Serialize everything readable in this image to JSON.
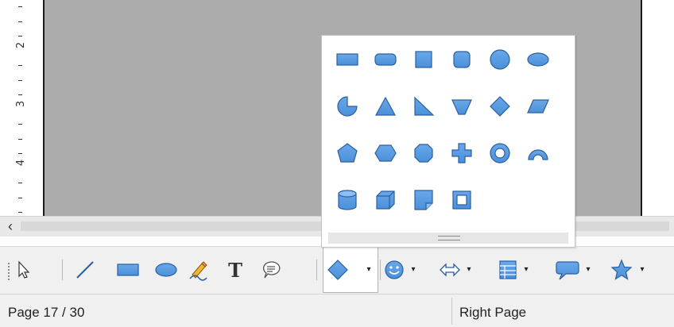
{
  "ruler": {
    "numbers": [
      "2",
      "3",
      "4"
    ]
  },
  "hscroll": {
    "left_arrow": "‹"
  },
  "drawing_toolbar": {
    "tools": [
      {
        "name": "select",
        "icon": "arrow-pointer-icon"
      },
      {
        "name": "line",
        "icon": "line-icon"
      },
      {
        "name": "rectangle",
        "icon": "rectangle-icon"
      },
      {
        "name": "ellipse",
        "icon": "ellipse-icon"
      },
      {
        "name": "freeform-line",
        "icon": "pencil-icon"
      },
      {
        "name": "text",
        "icon": "text-icon",
        "label": "T"
      },
      {
        "name": "callouts",
        "icon": "callout-icon"
      },
      {
        "name": "basic-shapes",
        "icon": "diamond-icon",
        "dropdown": true,
        "active": true
      },
      {
        "name": "symbol-shapes",
        "icon": "smiley-icon",
        "dropdown": true
      },
      {
        "name": "block-arrows",
        "icon": "double-arrow-icon",
        "dropdown": true
      },
      {
        "name": "flowchart",
        "icon": "flowchart-icon",
        "dropdown": true
      },
      {
        "name": "callout-shapes",
        "icon": "speech-bubble-icon",
        "dropdown": true
      },
      {
        "name": "stars",
        "icon": "star-icon",
        "dropdown": true
      }
    ],
    "dropdown_glyph": "▾"
  },
  "shape_popup": {
    "rows": [
      [
        "rectangle",
        "rounded-rectangle",
        "square",
        "rounded-square",
        "circle",
        "ellipse"
      ],
      [
        "circle-pie",
        "isosceles-triangle",
        "right-triangle",
        "trapezoid",
        "diamond",
        "parallelogram"
      ],
      [
        "pentagon",
        "hexagon",
        "octagon",
        "cross",
        "ring",
        "block-arc"
      ],
      [
        "cylinder",
        "cube",
        "folded-corner",
        "frame"
      ]
    ]
  },
  "status": {
    "page_count": "Page 17 / 30",
    "page_side": "Right Page"
  },
  "colors": {
    "shape_fill": "#4a90d9",
    "shape_stroke": "#2c5f9e",
    "canvas": "#acacac"
  }
}
